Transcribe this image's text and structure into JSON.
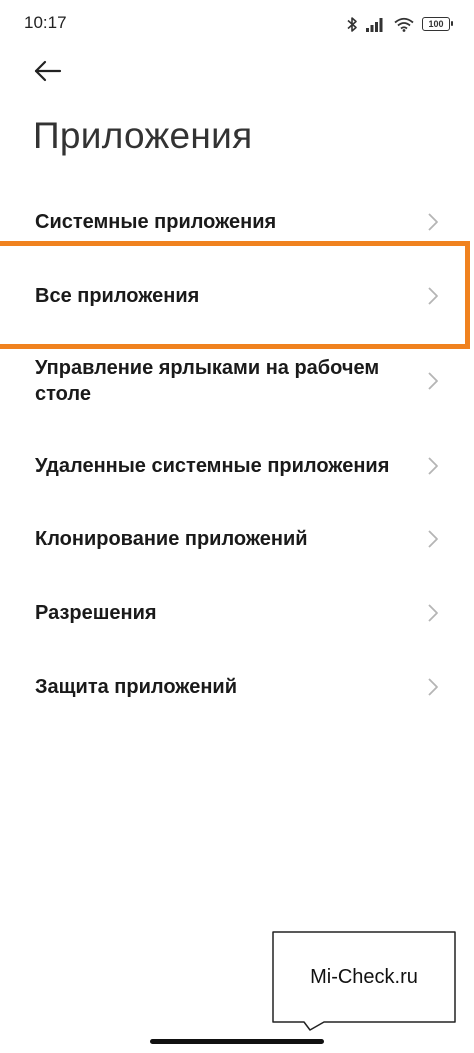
{
  "status_bar": {
    "time": "10:17",
    "battery": "100",
    "icons": [
      "bluetooth-icon",
      "signal-icon",
      "wifi-icon",
      "battery-icon"
    ]
  },
  "header": {
    "back_icon": "arrow-left-icon",
    "title": "Приложения"
  },
  "list": {
    "items": [
      {
        "label": "Системные приложения"
      },
      {
        "label": "Все приложения"
      },
      {
        "label": "Управление ярлыками на рабочем столе"
      },
      {
        "label": "Удаленные системные приложения"
      },
      {
        "label": "Клонирование приложений"
      },
      {
        "label": "Разрешения"
      },
      {
        "label": "Защита приложений"
      }
    ]
  },
  "highlight": {
    "color": "#f0821f",
    "target": "Все приложения"
  },
  "watermark": {
    "text": "Mi-Check.ru"
  }
}
